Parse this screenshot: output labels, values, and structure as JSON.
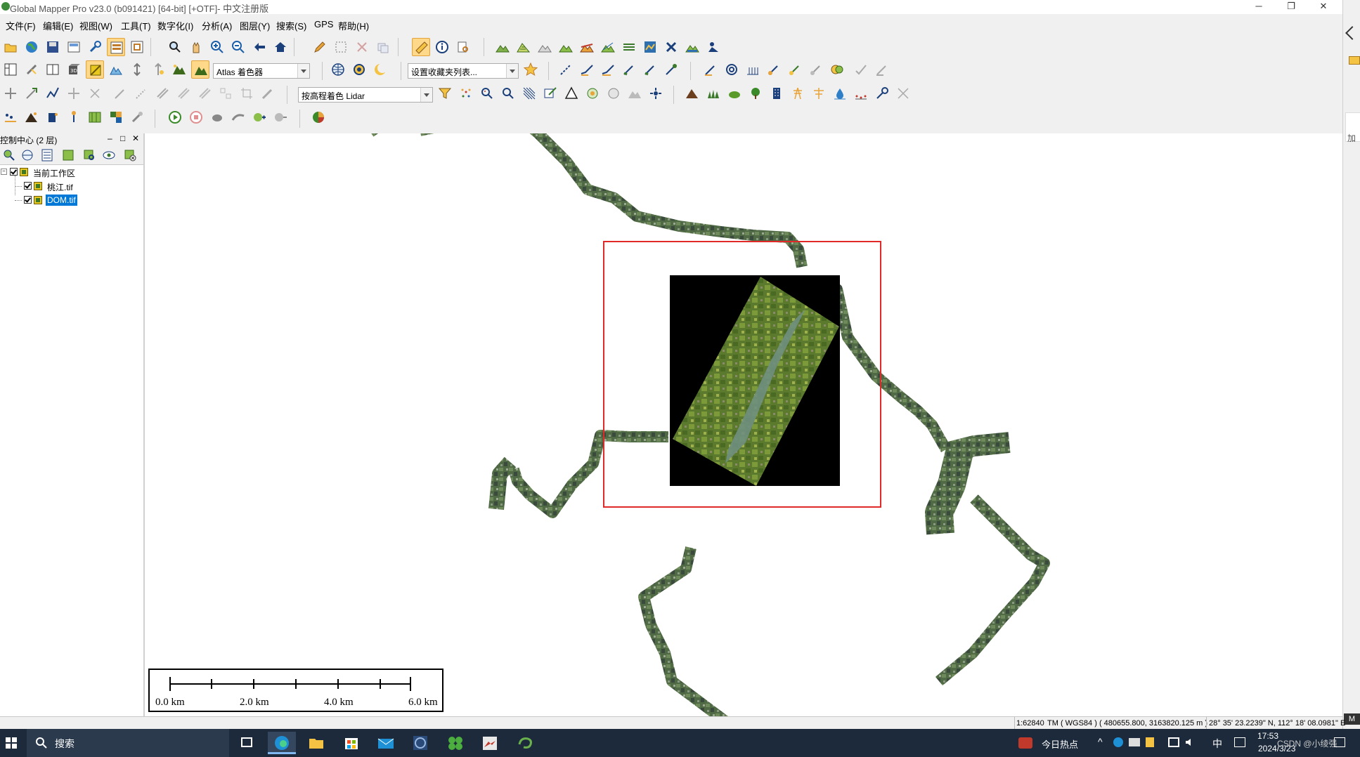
{
  "window": {
    "title": "Global Mapper Pro v23.0 (b091421) [64-bit] [+OTF]- 中文注册版",
    "minimize_glyph": "─",
    "restore_glyph": "❐",
    "close_glyph": "✕"
  },
  "menu": [
    {
      "label": "文件(F)"
    },
    {
      "label": "编辑(E)"
    },
    {
      "label": "视图(W)"
    },
    {
      "label": "工具(T)"
    },
    {
      "label": "数字化(I)"
    },
    {
      "label": "分析(A)"
    },
    {
      "label": "图层(Y)"
    },
    {
      "label": "搜索(S)"
    },
    {
      "label": "GPS"
    },
    {
      "label": "帮助(H)"
    }
  ],
  "toolbar": {
    "shader_combo_value": "Atlas 着色器",
    "favorites_combo_value": "设置收藏夹列表...",
    "elevation_color_combo_value": "按高程着色 Lidar"
  },
  "control_center": {
    "title": "控制中心 (2 层)",
    "minimize_glyph": "–",
    "float_glyph": "□",
    "close_glyph": "✕",
    "tree": {
      "root_label": "当前工作区",
      "layers": [
        {
          "label": "桃江.tif",
          "checked": true,
          "selected": false
        },
        {
          "label": "DOM.tif",
          "checked": true,
          "selected": true
        }
      ]
    }
  },
  "scale_bar": {
    "labels": [
      "0.0 km",
      "2.0 km",
      "4.0 km",
      "6.0 km"
    ]
  },
  "status": {
    "scale": "1:62840",
    "projection": "TM ( WGS84 ) ( 480655.800, 3163820.125 m )",
    "geo_coords": "28° 35' 23.2239\" N, 112° 18' 08.0981\" E"
  },
  "right_strip": {
    "label_top": "加",
    "label_bottom": "M"
  },
  "taskbar": {
    "search_placeholder": "搜索",
    "news_label": "今日热点",
    "ime_label": "中",
    "clock_time": "17:53",
    "clock_date": "2024/3/23",
    "watermark": "CSDN @小绫强"
  },
  "colors": {
    "highlight_rect": "#e02a2a",
    "selection": "#0078d7",
    "taskbar_bg": "#1c2a3b",
    "river_imagery": "#556b4a"
  }
}
